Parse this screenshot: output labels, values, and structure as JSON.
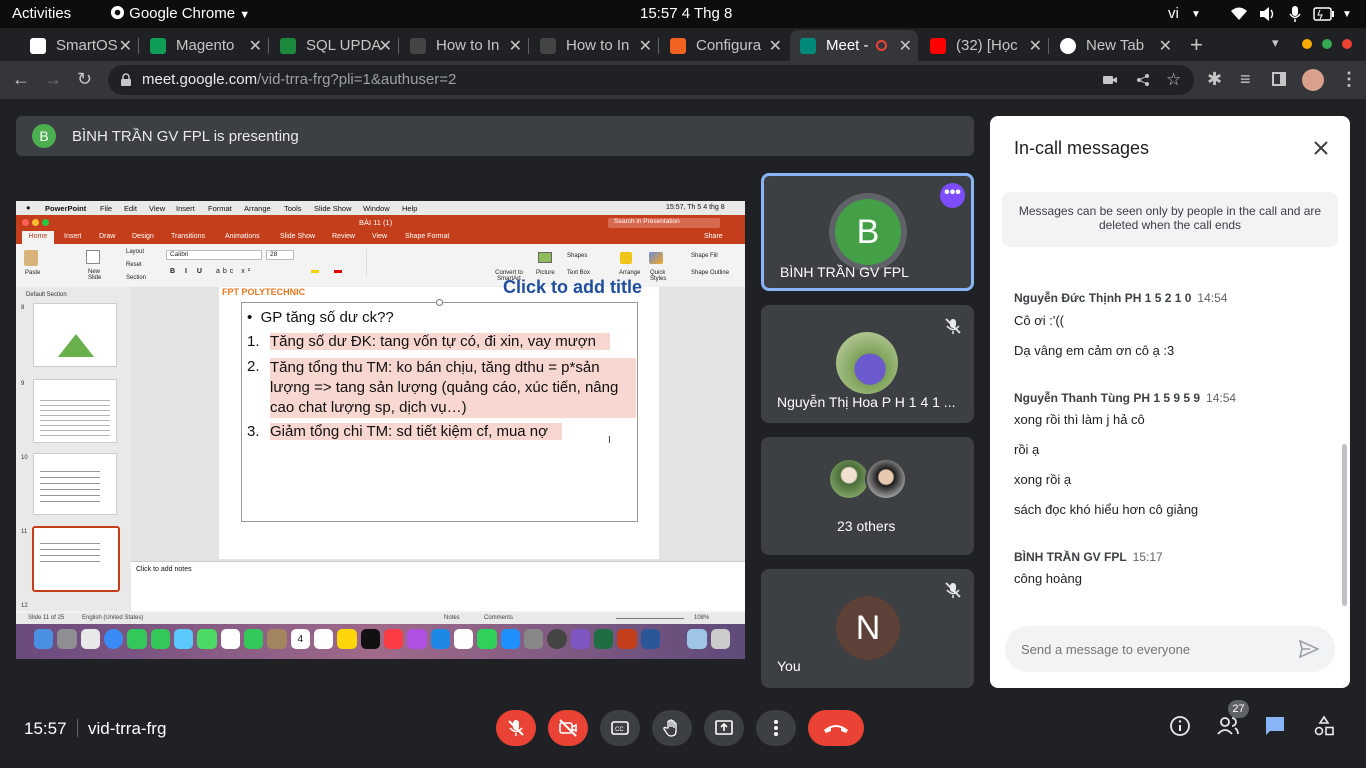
{
  "os_bar": {
    "activities": "Activities",
    "app": "Google Chrome",
    "clock": "15:57  4 Thg 8",
    "lang": "vi"
  },
  "tabs": [
    {
      "title": "SmartOS",
      "color": "#ffffff"
    },
    {
      "title": "Magento",
      "color": "#0f9d58"
    },
    {
      "title": "SQL UPDA",
      "color": "#1b8a3a"
    },
    {
      "title": "How to In",
      "color": "#202124"
    },
    {
      "title": "How to In",
      "color": "#202124"
    },
    {
      "title": "Configura",
      "color": "#f26322"
    },
    {
      "title": "Meet -",
      "color": "#00897b"
    },
    {
      "title": "(32) [Học",
      "color": "#ff0000"
    },
    {
      "title": "New Tab",
      "color": "#ffffff"
    }
  ],
  "url": {
    "host": "meet.google.com",
    "path": "/vid-trra-frg?pli=1&authuser=2"
  },
  "presenting": {
    "initial": "B",
    "text": "BÌNH TRẦN GV FPL is presenting"
  },
  "pptx": {
    "menu": [
      "PowerPoint",
      "File",
      "Edit",
      "View",
      "Insert",
      "Format",
      "Arrange",
      "Tools",
      "Slide Show",
      "Window",
      "Help"
    ],
    "mac_clock": "15:57, Th 5 4 thg 8",
    "doc_title": "BÀI 11 (1)",
    "search": "Search in Presentation",
    "share": "Share",
    "ribbon_tabs": [
      "Home",
      "Insert",
      "Draw",
      "Design",
      "Transitions",
      "Animations",
      "Slide Show",
      "Review",
      "View",
      "Shape Format"
    ],
    "font_name": "Calibri",
    "font_size": "28",
    "ribbon_labels": {
      "paste": "Paste",
      "new_slide": "New Slide",
      "layout": "Layout",
      "reset": "Reset",
      "section": "Section",
      "convert": "Convert to SmartArt",
      "picture": "Picture",
      "textbox": "Text Box",
      "arrange": "Arrange",
      "quick_styles": "Quick Styles",
      "shapes": "Shapes",
      "shape_fill": "Shape Fill",
      "shape_outline": "Shape Outline"
    },
    "section_label": "Default Section",
    "thumb_numbers": [
      "8",
      "9",
      "10",
      "11",
      "12"
    ],
    "slide_logo": "FPT POLYTECHNIC",
    "slide_title_placeholder": "Click to add title",
    "bullet": "GP tăng số dư ck??",
    "items": [
      {
        "num": "1.",
        "text": "Tăng số dư ĐK: tang vốn tự có, đi xin, vay mượn"
      },
      {
        "num": "2.",
        "text": "Tăng tổng thu TM: ko bán chịu, tăng dthu = p*sản lượng => tang sản lượng (quảng cáo, xúc tiến, nâng cao chat lượng sp, dịch vụ…)"
      },
      {
        "num": "3.",
        "text": "Giảm tổng chi TM: sd tiết kiệm cf, mua nợ"
      }
    ],
    "notes_placeholder": "Click to add notes",
    "status": {
      "slide": "Slide 11 of 25",
      "lang": "English (United States)",
      "notes": "Notes",
      "comments": "Comments",
      "zoom": "108%"
    },
    "dock_date": "4"
  },
  "tiles": [
    {
      "name": "BÌNH TRẦN GV FPL",
      "initial": "B",
      "color": "#43a047"
    },
    {
      "name": "Nguyễn Thị Hoa P H 1 4 1 ..."
    },
    {
      "name": "23 others"
    },
    {
      "name": "You",
      "initial": "N",
      "color": "#5d4037"
    }
  ],
  "chat": {
    "title": "In-call messages",
    "notice": "Messages can be seen only by people in the call and are deleted when the call ends",
    "groups": [
      {
        "name": "Nguyễn Đức Thịnh PH 1 5 2 1 0",
        "time": "14:54",
        "messages": [
          "Cô ơi :'((",
          "Dạ vâng em cảm ơn cô ạ :3"
        ]
      },
      {
        "name": "Nguyễn Thanh Tùng PH 1 5 9 5 9",
        "time": "14:54",
        "messages": [
          "xong rồi thì làm j hả cô",
          "rồi ạ",
          "xong rồi ạ",
          "sách đọc khó hiểu hơn cô giảng"
        ]
      },
      {
        "name": "BÌNH TRẦN GV FPL",
        "time": "15:17",
        "messages": [
          "công hoàng"
        ]
      }
    ],
    "input_placeholder": "Send a message to everyone"
  },
  "meeting": {
    "time": "15:57",
    "code": "vid-trra-frg",
    "people_count": "27"
  }
}
